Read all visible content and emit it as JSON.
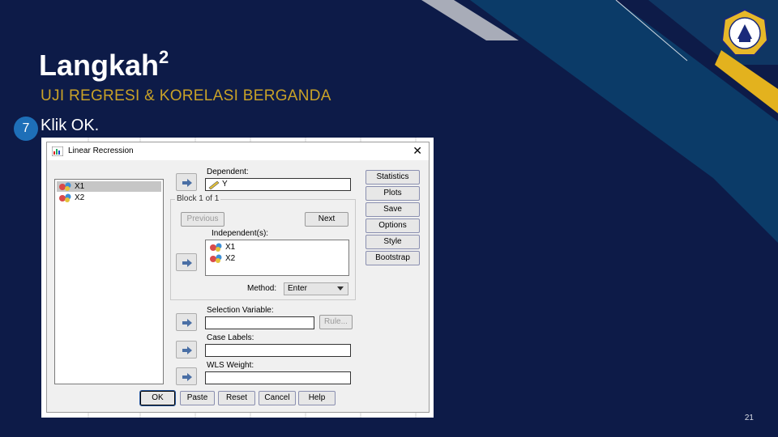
{
  "slide": {
    "title": "Langkah",
    "title_superscript": "2",
    "subtitle": "UJI REGRESI & KORELASI BERGANDA",
    "step_number": "7",
    "step_text": "Klik OK.",
    "page_number": "21"
  },
  "dialog": {
    "title": "Linear Recression",
    "close_label": "✕",
    "variables": [
      {
        "label": "X1",
        "selected": true
      },
      {
        "label": "X2",
        "selected": false
      }
    ],
    "dependent_label": "Dependent:",
    "dependent_value": "Y",
    "block_label": "Block 1 of 1",
    "previous_label": "Previous",
    "next_label": "Next",
    "independent_label": "Independent(s):",
    "independents": [
      "X1",
      "X2"
    ],
    "method_label": "Method:",
    "method_value": "Enter",
    "selection_label": "Selection Variable:",
    "rule_label": "Rule...",
    "case_labels_label": "Case Labels:",
    "wls_label": "WLS Weight:",
    "side_buttons": [
      "Statistics",
      "Plots",
      "Save",
      "Options",
      "Style",
      "Bootstrap"
    ],
    "bottom_buttons": [
      "OK",
      "Paste",
      "Reset",
      "Cancel",
      "Help"
    ]
  },
  "colors": {
    "background": "#0d1b48",
    "accent_gold": "#c9a227",
    "badge_blue": "#1e6fb8"
  }
}
